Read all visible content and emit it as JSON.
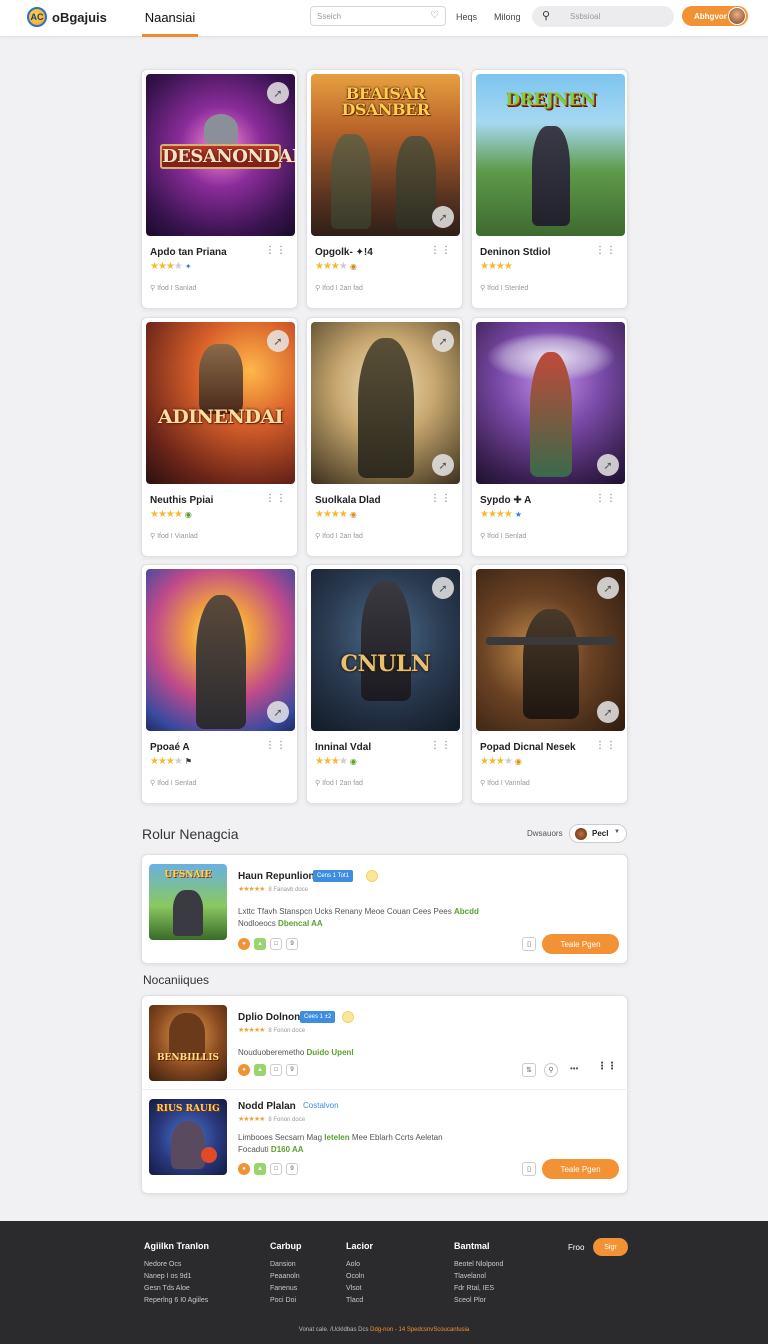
{
  "header": {
    "logo_badge": "AC",
    "logo_text": "oBgajuis",
    "nav_active": "Naansiai",
    "search_placeholder": "Sseich",
    "links": [
      "Heqs",
      "Milong"
    ],
    "search2_placeholder": "Ssbsioal",
    "cta_label": "Abhgvor"
  },
  "games": [
    {
      "name": "Apdo tan Priana",
      "art_title": "DESANONDAN",
      "stars": 3,
      "meta": "Ifod I Sanlad"
    },
    {
      "name": "Opgolk- ✦!4",
      "art_title": "BEAISAR DSANBER",
      "stars": 3,
      "meta": "Ifod I 2an fad"
    },
    {
      "name": "Deninon Stdiol",
      "art_title": "DREJNEN",
      "stars": 4,
      "meta": "Ifod I Stenled"
    },
    {
      "name": "Neuthis Ppiai",
      "art_title": "ADINENDAI",
      "stars": 4,
      "meta": "Ifod I Vianlad"
    },
    {
      "name": "Suolkala Dlad",
      "art_title": "",
      "stars": 4,
      "meta": "Ifod I 2an fad"
    },
    {
      "name": "Sypdo ✚ A",
      "art_title": "",
      "stars": 4,
      "meta": "Ifod I Senlad"
    },
    {
      "name": "Ppoaé A",
      "art_title": "",
      "stars": 3,
      "meta": "Ifod I Senlad"
    },
    {
      "name": "Inninal Vdal",
      "art_title": "CNULN",
      "stars": 3,
      "meta": "Ifod I 2an fad"
    },
    {
      "name": "Popad Dicnal Nesek",
      "art_title": "",
      "stars": 3,
      "meta": "Ifod I Vannlad"
    }
  ],
  "section1": {
    "title": "Rolur Nenagcia",
    "sort_label": "Dwsauors",
    "sort_value": "Pecl",
    "item": {
      "thumb_title": "UFSNAIE",
      "title": "Haun Repunlion",
      "badge": "Cens 1 Tot1",
      "stars": "★★★★★",
      "star_text": "8 Fanavb doce",
      "desc_line1": "Lxttc Tfavh Stanspcn Ucks Renany Meoe Couan Cees Pees",
      "desc_hl1": "Abcdd",
      "desc_line2": "Nodloeocs",
      "desc_hl2": "Dbencal AA",
      "num": "9",
      "cta": "Teale Pgen"
    }
  },
  "section2": {
    "title": "Nocaniiques",
    "items": [
      {
        "thumb_title": "BENBIILLIS",
        "title": "Dplio Dolnon",
        "badge": "Cees 1 ±2",
        "stars": "★★★★★",
        "star_text": "8 Fonon doce",
        "desc_line1": "Nouduoberemetho",
        "desc_hl1": "Duido Upenl",
        "desc_line2": "",
        "desc_hl2": "",
        "num": "9",
        "cta": ""
      },
      {
        "thumb_title": "RIUS RAUIG",
        "title": "Nodd Plalan",
        "badge": "Costalvon",
        "stars": "★★★★★",
        "star_text": "8 Fonon doce",
        "desc_line1": "Limbooes Secsarn Mag",
        "desc_hl1": "Ietelen",
        "desc_line1b": "Mee Eblarh Ccrts Aeletan",
        "desc_line2": "Focaduti",
        "desc_hl2": "D160 AA",
        "num": "9",
        "cta": "Teale Pgen"
      }
    ]
  },
  "footer": {
    "cols": [
      {
        "head": "Agiilkn Tranlon",
        "items": [
          "Nedore Ocs",
          "Nanep I os 9d1",
          "Gesn Tds Aloe",
          "Reperlng 6 I0 Agiiles"
        ]
      },
      {
        "head": "Carbup",
        "items": [
          "Dansion",
          "Peaanoln",
          "Fanenus",
          "Poci Doi"
        ]
      },
      {
        "head": "Lacior",
        "items": [
          "Aolo",
          "Ocoln",
          "Vlsot",
          "Tlacd"
        ]
      },
      {
        "head": "Bantmal",
        "items": [
          "Beotel Nlolpond",
          "Tlavelanol",
          "Fdr Rtal, IES",
          "Sceol Plor"
        ]
      }
    ],
    "cta_label": "Froo",
    "cta": "Sigr",
    "copyright": "Vonat cale. /Uckldbas Dcs",
    "copyright_link": "Ddg-non - 14 SpedcsnvScoucantusia"
  }
}
